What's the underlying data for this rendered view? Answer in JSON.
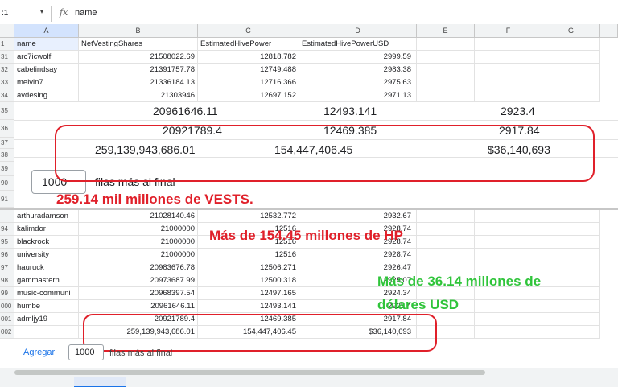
{
  "formula_bar": {
    "cell_ref": ":1",
    "fx": "fx",
    "value": "name"
  },
  "columns": [
    "A",
    "B",
    "C",
    "D",
    "E",
    "F",
    "G"
  ],
  "header_row": {
    "num": "1",
    "cells": [
      "name",
      "NetVestingShares",
      "EstimatedHivePower",
      "EstimatedHivePowerUSD"
    ]
  },
  "top_rows": [
    {
      "num": "31",
      "cells": [
        "arc7icwolf",
        "21508022.69",
        "12818.782",
        "2999.59"
      ]
    },
    {
      "num": "32",
      "cells": [
        "cabelindsay",
        "21391757.78",
        "12749.488",
        "2983.38"
      ]
    },
    {
      "num": "33",
      "cells": [
        "melvin7",
        "21336184.13",
        "12716.366",
        "2975.63"
      ]
    },
    {
      "num": "34",
      "cells": [
        "avdesing",
        "21303946",
        "12697.152",
        "2971.13"
      ]
    }
  ],
  "big_rows": [
    {
      "num": "35",
      "cells": [
        "20961646.11",
        "12493.141",
        "2923.4"
      ]
    },
    {
      "num": "37",
      "cells": [
        "20921789.4",
        "12469.385",
        "2917.84"
      ]
    },
    {
      "num": "38",
      "cells": [
        "259,139,943,686.01",
        "154,447,406.45",
        "$36,140,693"
      ]
    }
  ],
  "big_row_extra_nums": [
    "39",
    "90",
    "91"
  ],
  "add_rows": {
    "count": "1000",
    "label": "filas más al final"
  },
  "bottom_rows": [
    {
      "num": "",
      "cells": [
        "arthuradamson",
        "21028140.46",
        "12532.772",
        "2932.67"
      ]
    },
    {
      "num": "94",
      "cells": [
        "kalimdor",
        "21000000",
        "12516",
        "2928.74"
      ]
    },
    {
      "num": "95",
      "cells": [
        "blackrock",
        "21000000",
        "12516",
        "2928.74"
      ]
    },
    {
      "num": "96",
      "cells": [
        "university",
        "21000000",
        "12516",
        "2928.74"
      ]
    },
    {
      "num": "97",
      "cells": [
        "hauruck",
        "20983676.78",
        "12506.271",
        "2926.47"
      ]
    },
    {
      "num": "98",
      "cells": [
        "gammastern",
        "20973687.99",
        "12500.318",
        "2925.07"
      ]
    },
    {
      "num": "99",
      "cells": [
        "music-communi",
        "20968397.54",
        "12497.165",
        "2924.34"
      ]
    },
    {
      "num": "000",
      "cells": [
        "humbe",
        "20961646.11",
        "12493.141",
        "2923.4"
      ]
    },
    {
      "num": "001",
      "cells": [
        "admljy19",
        "20921789.4",
        "12469.385",
        "2917.84"
      ]
    },
    {
      "num": "002",
      "cells": [
        "",
        "259,139,943,686.01",
        "154,447,406.45",
        "$36,140,693"
      ]
    }
  ],
  "annotations": {
    "vests": "259.14 mil millones de VESTS.",
    "hp": "Más de 154.45 millones de HP",
    "usd_line1": "Más de 36.14 millones de",
    "usd_line2": "dólares USD"
  },
  "footer": {
    "add_label": "Agregar",
    "count": "1000",
    "label": "filas más al final"
  },
  "colors": {
    "annotation_red": "#e0202a",
    "annotation_green": "#2fc43a",
    "link_blue": "#1a73e8"
  }
}
